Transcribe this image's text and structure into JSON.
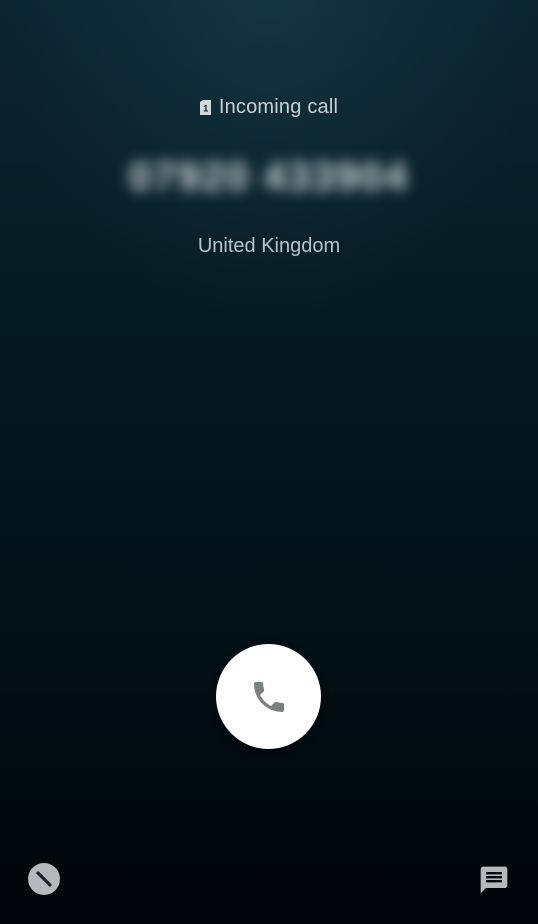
{
  "call": {
    "status_label": "Incoming call",
    "sim_slot": "1",
    "caller_number": "07920 433904",
    "caller_location": "United Kingdom"
  },
  "actions": {
    "answer_icon": "phone-icon",
    "decline_icon": "block-icon",
    "message_icon": "message-icon"
  },
  "colors": {
    "background_top": "#0a2530",
    "background_bottom": "#000508",
    "answer_button_bg": "#ffffff",
    "answer_icon": "#7a7f82",
    "text_primary": "#c9d1d5"
  }
}
